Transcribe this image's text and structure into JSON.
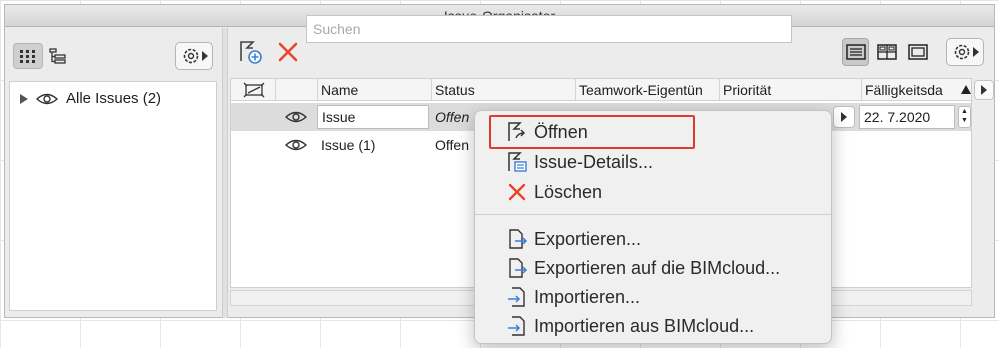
{
  "window": {
    "title": "Issue-Organisator"
  },
  "left_panel": {
    "tree": [
      {
        "label": "Alle Issues (2)"
      }
    ]
  },
  "toolbar": {
    "search_placeholder": "Suchen"
  },
  "table": {
    "columns": [
      "Name",
      "Status",
      "Teamwork-Eigentün",
      "Priorität",
      "Fälligkeitsda"
    ],
    "rows": [
      {
        "name": "Issue",
        "status": "Offen",
        "due": "22. 7.2020",
        "selected": true
      },
      {
        "name": "Issue (1)",
        "status": "Offen",
        "selected": false
      }
    ]
  },
  "context_menu": {
    "items": [
      {
        "label": "Öffnen",
        "icon": "open-issue-icon"
      },
      {
        "label": "Issue-Details...",
        "icon": "issue-details-icon"
      },
      {
        "label": "Löschen",
        "icon": "delete-x-icon"
      },
      {
        "label": "Exportieren...",
        "icon": "export-icon"
      },
      {
        "label": "Exportieren auf die BIMcloud...",
        "icon": "export-icon"
      },
      {
        "label": "Importieren...",
        "icon": "import-icon"
      },
      {
        "label": "Importieren aus BIMcloud...",
        "icon": "import-icon"
      }
    ]
  },
  "colors": {
    "highlight": "#e03a2f",
    "delete": "#e8452c",
    "accent": "#3c7fd6"
  }
}
